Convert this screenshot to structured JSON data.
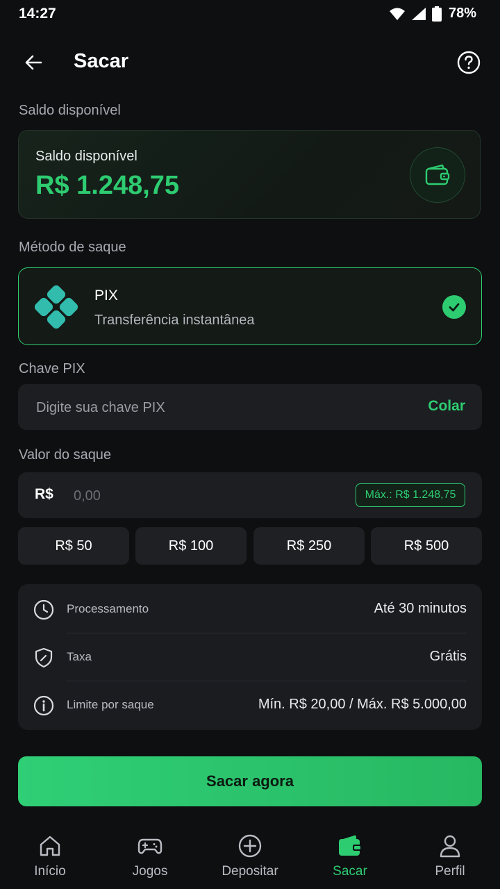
{
  "status_bar": {
    "time": "14:27",
    "battery": "78%"
  },
  "app_bar": {
    "title": "Sacar"
  },
  "balance_section": {
    "label": "Saldo disponível",
    "card_label": "Saldo disponível",
    "value": "R$ 1.248,75"
  },
  "method_section": {
    "label": "Método de saque",
    "method_name": "PIX",
    "method_desc": "Transferência instantânea"
  },
  "pix_key": {
    "label": "Chave PIX",
    "placeholder": "Digite sua chave PIX",
    "paste_label": "Colar"
  },
  "amount": {
    "label": "Valor do saque",
    "currency": "R$",
    "placeholder": "0,00",
    "max_label": "Máx.: R$ 1.248,75"
  },
  "quick_amounts": [
    "R$ 50",
    "R$ 100",
    "R$ 250",
    "R$ 500"
  ],
  "info": [
    {
      "icon": "clock-icon",
      "label": "Processamento",
      "value": "Até 30 minutos"
    },
    {
      "icon": "shield-icon",
      "label": "Taxa",
      "value": "Grátis"
    },
    {
      "icon": "info-icon",
      "label": "Limite por saque",
      "value": "Mín. R$ 20,00 / Máx. R$ 5.000,00"
    }
  ],
  "cta": {
    "label": "Sacar agora"
  },
  "bottom_nav": [
    {
      "icon": "home-icon",
      "label": "Início",
      "active": false
    },
    {
      "icon": "gamepad-icon",
      "label": "Jogos",
      "active": false
    },
    {
      "icon": "plus-circle-icon",
      "label": "Depositar",
      "active": false
    },
    {
      "icon": "wallet-icon",
      "label": "Sacar",
      "active": true
    },
    {
      "icon": "user-icon",
      "label": "Perfil",
      "active": false
    }
  ],
  "colors": {
    "accent": "#2ecc71",
    "background": "#0e0f11",
    "surface": "#1c1e22"
  }
}
